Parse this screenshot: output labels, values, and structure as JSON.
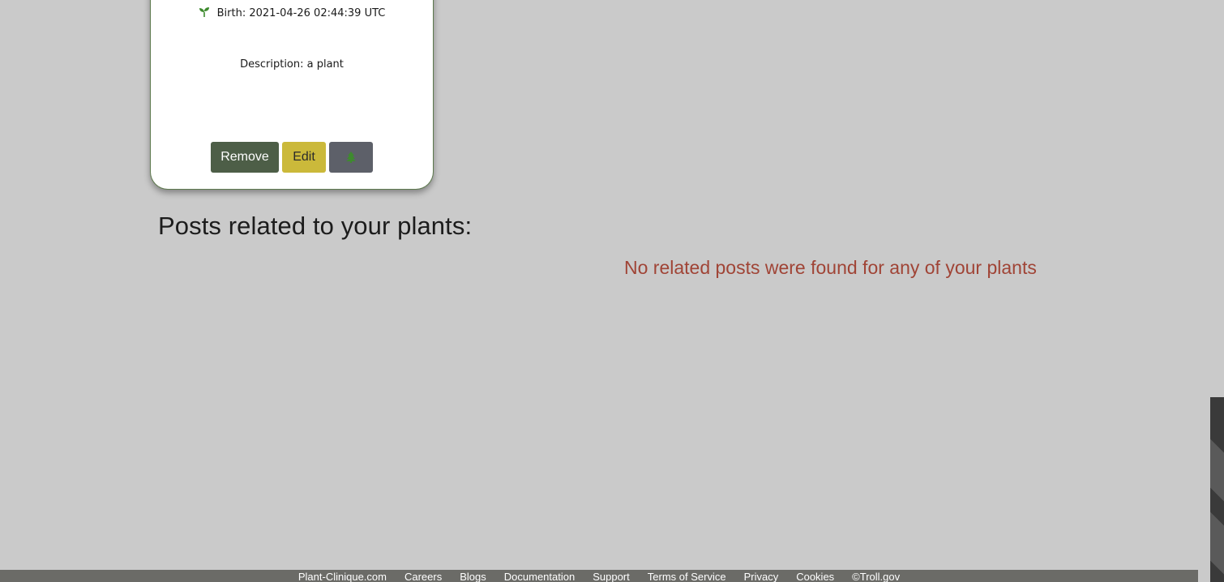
{
  "plant_card": {
    "birth_label": "Birth: 2021-04-26 02:44:39 UTC",
    "description": "Description: a plant",
    "buttons": {
      "remove": "Remove",
      "edit": "Edit",
      "tree_icon": "tree-icon"
    },
    "sprout_icon": "sprout-icon"
  },
  "posts_section": {
    "heading": "Posts related to your plants:",
    "empty_message": "No related posts were found for any of your plants"
  },
  "footer": {
    "links": [
      "Plant-Clinique.com",
      "Careers",
      "Blogs",
      "Documentation",
      "Support",
      "Terms of Service",
      "Privacy",
      "Cookies",
      "©Troll.gov"
    ]
  },
  "colors": {
    "background": "#cacaca",
    "remove_button": "#4d5e47",
    "edit_button": "#cbb93a",
    "tree_button": "#5d6069",
    "empty_message": "#a04436",
    "footer": "#6b6b67",
    "icon_green": "#3e8a2e"
  }
}
